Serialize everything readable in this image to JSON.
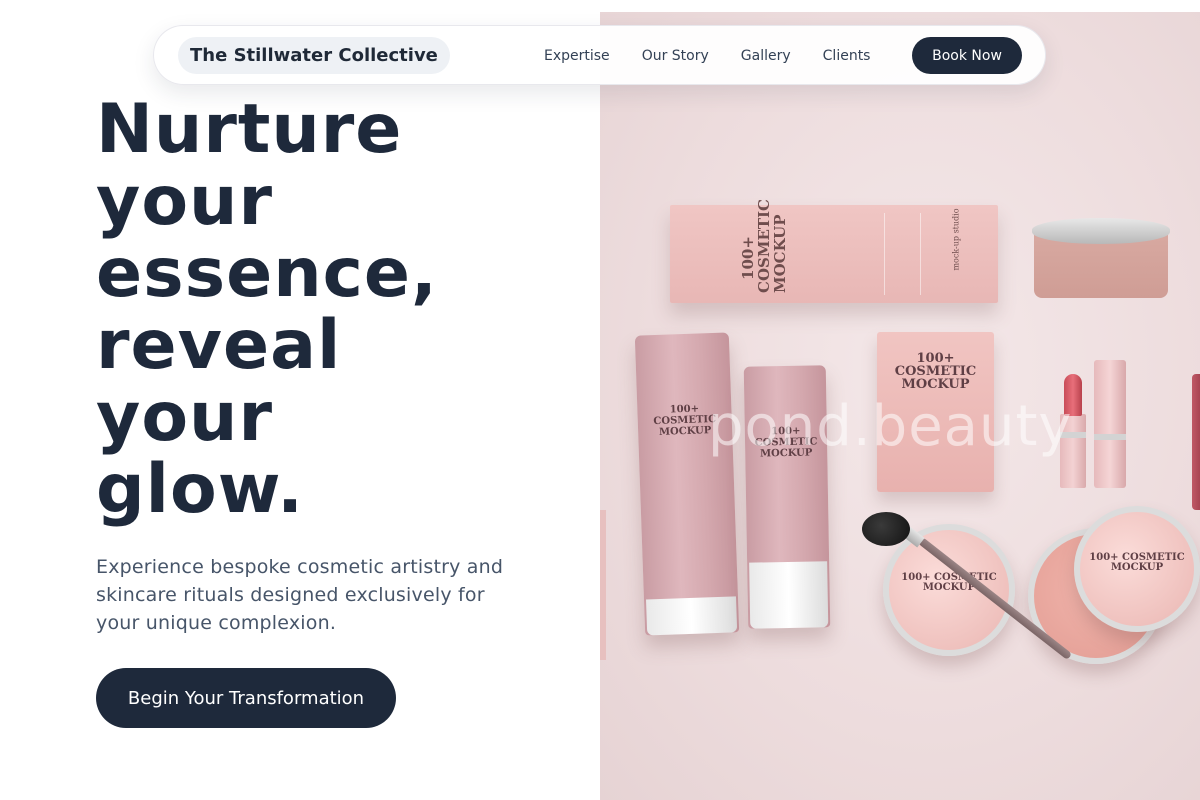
{
  "nav": {
    "brand": "The Stillwater Collective",
    "links": [
      "Expertise",
      "Our Story",
      "Gallery",
      "Clients"
    ],
    "cta": "Book Now"
  },
  "hero": {
    "headline_lines": [
      "Nurture",
      "your",
      "essence,",
      "reveal",
      "your",
      "glow."
    ],
    "subtitle": "Experience bespoke cosmetic artistry and skincare rituals designed exclusively for your unique complexion.",
    "cta": "Begin Your Transformation"
  },
  "image": {
    "watermark": "pond.beauty",
    "packaging_text": "100+ COSMETIC MOCKUP",
    "packaging_small": "mock-up studio"
  },
  "colors": {
    "navy": "#1e293b",
    "text_gray": "#475569",
    "blush_bg": "#efdfe0"
  }
}
